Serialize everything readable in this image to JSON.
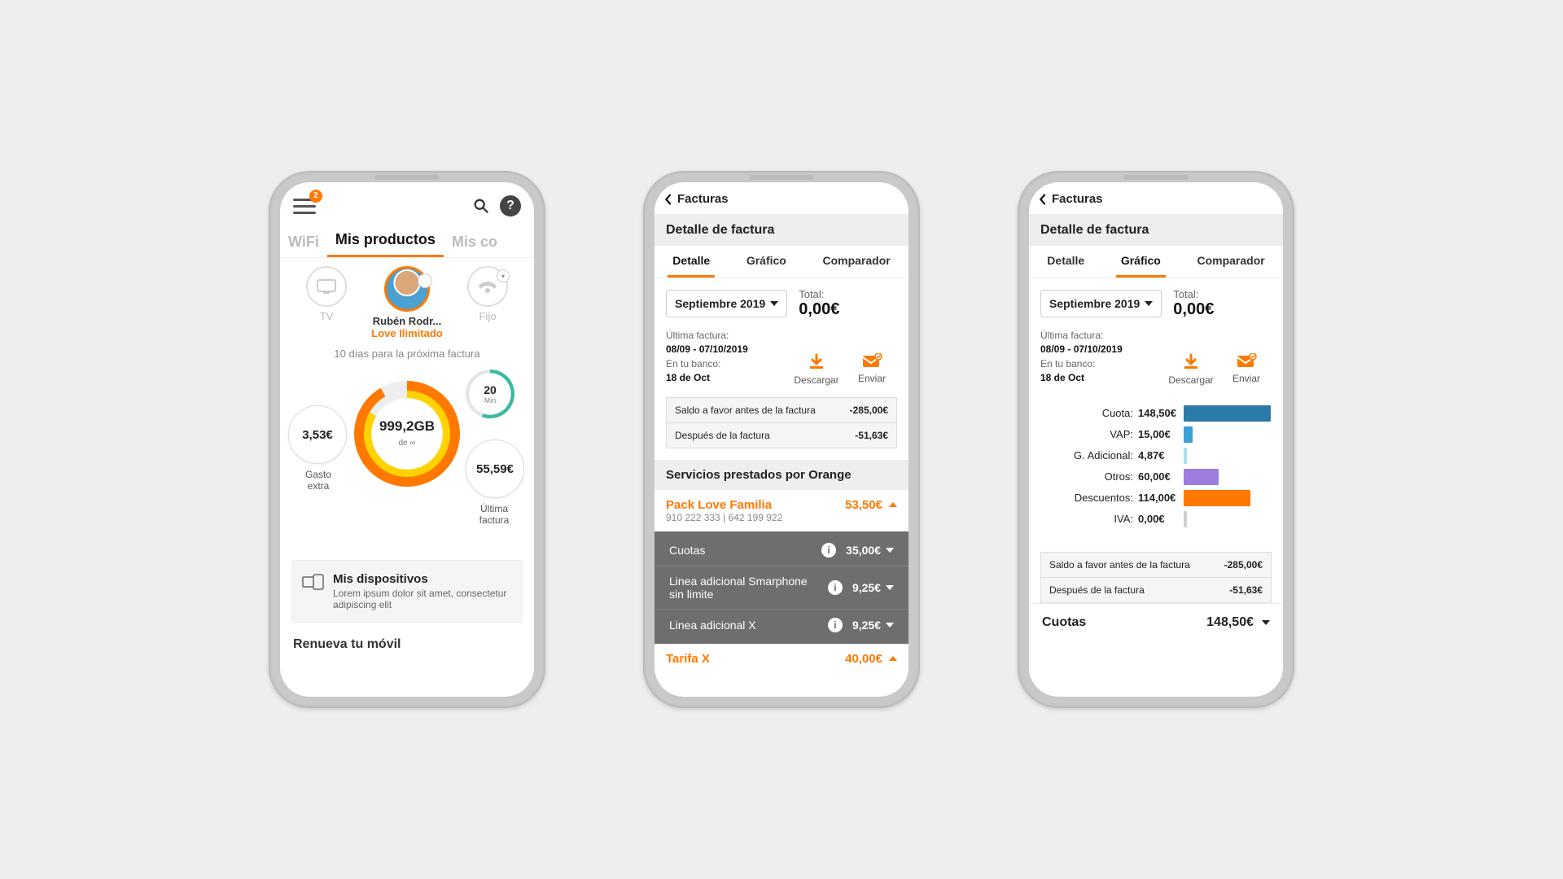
{
  "screen1": {
    "badge_count": "2",
    "tabs": {
      "left": "WiFi",
      "center": "Mis productos",
      "right": "Mis co"
    },
    "products": {
      "tv": "TV",
      "fijo": "Fijo",
      "user_name": "Rubén Rodr...",
      "plan": "Love Ilimitado",
      "next_bill": "10 días para la próxima factura"
    },
    "data_ring": {
      "value": "999,2GB",
      "sub": "de ∞"
    },
    "mins_ring": {
      "value": "20",
      "unit": "Min"
    },
    "extra": {
      "amount": "3,53€",
      "label": "Gasto\nextra"
    },
    "last_bill": {
      "amount": "55,59€",
      "label": "Última\nfactura"
    },
    "devices": {
      "title": "Mis dispositivos",
      "body": "Lorem ipsum dolor sit amet, consectetur adipiscing elit"
    },
    "renew": "Renueva tu móvil"
  },
  "screen2": {
    "back": "Facturas",
    "title": "Detalle de factura",
    "tabs": {
      "detail": "Detalle",
      "chart": "Gráfico",
      "compare": "Comparador"
    },
    "period": "Septiembre 2019",
    "total_label": "Total:",
    "total": "0,00€",
    "meta": {
      "last_label": "Última factura:",
      "period": "08/09 - 07/10/2019",
      "bank_label": "En tu banco:",
      "bank_date": "18 de Oct"
    },
    "actions": {
      "download": "Descargar",
      "send": "Enviar"
    },
    "balance": {
      "before_label": "Saldo a favor antes de la factura",
      "before": "-285,00€",
      "after_label": "Después de la factura",
      "after": "-51,63€"
    },
    "services_title": "Servicios prestados por Orange",
    "pack": {
      "name": "Pack Love Familia",
      "amount": "53,50€",
      "lines": "910 222 333 | 642 199 922"
    },
    "items": [
      {
        "label": "Cuotas",
        "amount": "35,00€"
      },
      {
        "label": "Linea adicional Smarphone sin limite",
        "amount": "9,25€"
      },
      {
        "label": "Linea adicional X",
        "amount": "9,25€"
      }
    ],
    "tarifa": {
      "name": "Tarifa X",
      "amount": "40,00€"
    }
  },
  "screen3": {
    "back": "Facturas",
    "title": "Detalle de factura",
    "tabs": {
      "detail": "Detalle",
      "chart": "Gráfico",
      "compare": "Comparador"
    },
    "period": "Septiembre 2019",
    "total_label": "Total:",
    "total": "0,00€",
    "meta": {
      "last_label": "Última factura:",
      "period": "08/09 - 07/10/2019",
      "bank_label": "En tu banco:",
      "bank_date": "18 de Oct"
    },
    "actions": {
      "download": "Descargar",
      "send": "Enviar"
    },
    "balance": {
      "before_label": "Saldo a favor antes de la factura",
      "before": "-285,00€",
      "after_label": "Después de la factura",
      "after": "-51,63€"
    },
    "cuotas_label": "Cuotas",
    "cuotas_amount": "148,50€"
  },
  "chart_data": {
    "type": "bar",
    "orientation": "horizontal",
    "title": "",
    "xlabel": "",
    "ylabel": "",
    "categories": [
      "Cuota",
      "VAP",
      "G. Adicional",
      "Otros",
      "Descuentos",
      "IVA"
    ],
    "values": [
      148.5,
      15.0,
      4.87,
      60.0,
      114.0,
      0.0
    ],
    "value_labels": [
      "148,50€",
      "15,00€",
      "4,87€",
      "60,00€",
      "114,00€",
      "0,00€"
    ],
    "colors": [
      "#2b7aa8",
      "#3aa0d8",
      "#a7dff1",
      "#9d7de0",
      "#ff7900",
      "#cfcfcf"
    ],
    "xlim": [
      0,
      150
    ]
  }
}
